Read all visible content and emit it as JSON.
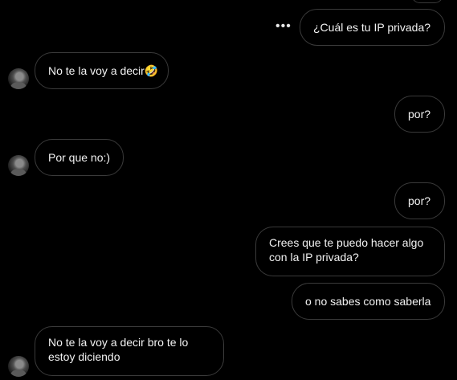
{
  "conversation": {
    "more_options_icon": "more-options-icon",
    "avatar_icon": "avatar-icon",
    "messages": [
      {
        "sender": "me",
        "text": "¿Cuál es tu IP privada?"
      },
      {
        "sender": "other",
        "text": "No te la voy a decir🤣"
      },
      {
        "sender": "me",
        "text": "por?"
      },
      {
        "sender": "other",
        "text": "Por que no:)"
      },
      {
        "sender": "me",
        "text": "por?"
      },
      {
        "sender": "me",
        "text": "Crees que te puedo hacer algo con la IP privada?"
      },
      {
        "sender": "me",
        "text": "o no sabes como saberla"
      },
      {
        "sender": "other",
        "text": "No te la voy a decir bro te lo estoy diciendo"
      }
    ]
  },
  "colors": {
    "background": "#000000",
    "bubble_border": "#3a3a3a",
    "text": "#f2f2f2"
  }
}
